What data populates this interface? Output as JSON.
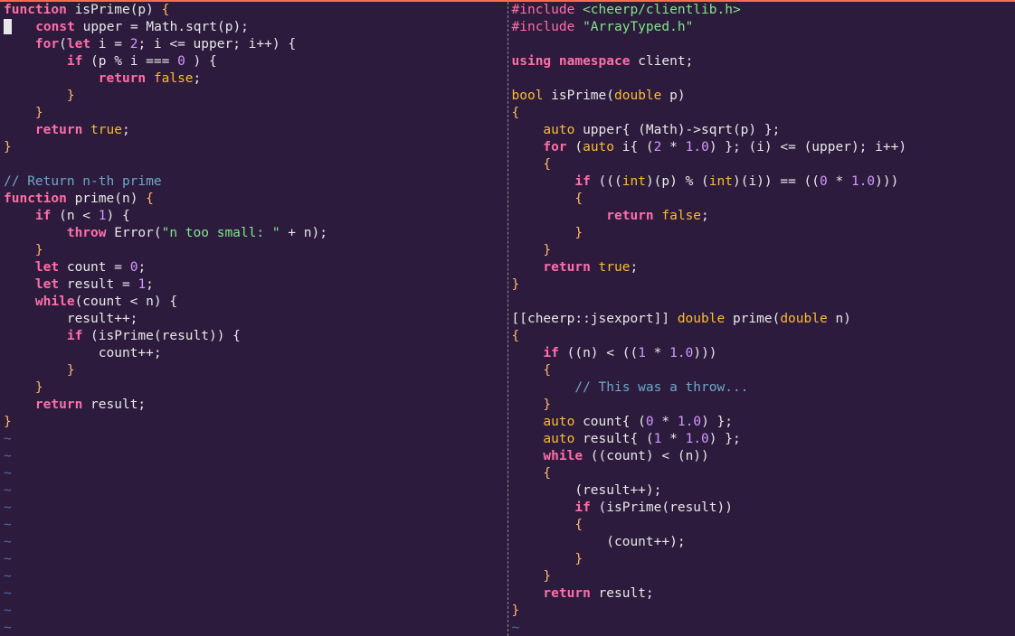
{
  "left": {
    "l1_fn": "function",
    "l1_name": "isPrime",
    "l1_p": "(p)",
    "l1_brace": " {",
    "l2_kw": "const",
    "l2_rest": " upper = Math.sqrt(p);",
    "l3_for": "for",
    "l3_open": "(",
    "l3_let": "let",
    "l3_rest1": " i = ",
    "l3_n2": "2",
    "l3_rest2": "; i <= upper; i++) {",
    "l4_if": "if",
    "l4_rest1": " (p % i === ",
    "l4_n0": "0",
    "l4_rest2": " ) {",
    "l5_ret": "return",
    "l5_sp": " ",
    "l5_false": "false",
    "l5_semi": ";",
    "l6": "        }",
    "l7": "    }",
    "l8_ret": "return",
    "l8_sp": " ",
    "l8_true": "true",
    "l8_semi": ";",
    "l9": "}",
    "blank": "",
    "c1": "// Return n-th prime",
    "p1_fn": "function",
    "p1_name": "prime",
    "p1_p": "(n)",
    "p1_brace": " {",
    "p2_if": "if",
    "p2_rest1": " (n < ",
    "p2_n1": "1",
    "p2_rest2": ") {",
    "p3_throw": "throw",
    "p3_err": " Error(",
    "p3_str": "\"n too small: \"",
    "p3_rest": " + n);",
    "p4": "    }",
    "p5_let": "let",
    "p5_rest": " count = ",
    "p5_n0": "0",
    "p5_semi": ";",
    "p6_let": "let",
    "p6_rest": " result = ",
    "p6_n1": "1",
    "p6_semi": ";",
    "p7_while": "while",
    "p7_rest": "(count < n) {",
    "p8": "        result++;",
    "p9_if": "if",
    "p9_rest": " (isPrime(result)) {",
    "p10": "            count++;",
    "p11": "        }",
    "p12": "    }",
    "p13_ret": "return",
    "p13_rest": " result;",
    "p14": "}",
    "tilde": "~"
  },
  "right": {
    "i1_inc": "#include ",
    "i1_val": "<cheerp/clientlib.h>",
    "i2_inc": "#include ",
    "i2_val": "\"ArrayTyped.h\"",
    "u1_using": "using",
    "u1_ns": " namespace ",
    "u1_client": "client",
    "u1_semi": ";",
    "f1_bool": "bool",
    "f1_name": " isPrime(",
    "f1_dbl": "double",
    "f1_rest": " p)",
    "f2": "{",
    "f3_auto": "auto",
    "f3_rest": " upper{ (Math)->sqrt(p) };",
    "f4_for": "for",
    "f4_open": " (",
    "f4_auto": "auto",
    "f4_rest1": " i{ (",
    "f4_n2": "2",
    "f4_rest2": " * ",
    "f4_n1": "1.0",
    "f4_rest3": ") }; (i) <= (upper); i++)",
    "f5": "    {",
    "f6_if": "if",
    "f6_rest1": " (((",
    "f6_int1": "int",
    "f6_rest2": ")(p) % (",
    "f6_int2": "int",
    "f6_rest3": ")(i)) == ((",
    "f6_n0": "0",
    "f6_rest4": " * ",
    "f6_n1": "1.0",
    "f6_rest5": ")))",
    "f7": "        {",
    "f8_ret": "return",
    "f8_sp": " ",
    "f8_false": "false",
    "f8_semi": ";",
    "f9": "        }",
    "f10": "    }",
    "f11_ret": "return",
    "f11_sp": " ",
    "f11_true": "true",
    "f11_semi": ";",
    "f12": "}",
    "g1_attr": "[[cheerp::jsexport]] ",
    "g1_dbl": "double",
    "g1_name": " prime(",
    "g1_dbl2": "double",
    "g1_rest": " n)",
    "g2": "{",
    "g3_if": "if",
    "g3_rest1": " ((n) < ((",
    "g3_n1": "1",
    "g3_rest2": " * ",
    "g3_n1b": "1.0",
    "g3_rest3": ")))",
    "g4": "    {",
    "g5_cmt": "// This was a throw...",
    "g6": "    }",
    "g7_auto": "auto",
    "g7_rest1": " count{ (",
    "g7_n0": "0",
    "g7_rest2": " * ",
    "g7_n1": "1.0",
    "g7_rest3": ") };",
    "g8_auto": "auto",
    "g8_rest1": " result{ (",
    "g8_n1": "1",
    "g8_rest2": " * ",
    "g8_n1b": "1.0",
    "g8_rest3": ") };",
    "g9_while": "while",
    "g9_rest": " ((count) < (n))",
    "g10": "    {",
    "g11": "        (result++);",
    "g12_if": "if",
    "g12_rest": " (isPrime(result))",
    "g13": "        {",
    "g14": "            (count++);",
    "g15": "        }",
    "g16": "    }",
    "g17_ret": "return",
    "g17_rest": " result;",
    "g18": "}",
    "tilde": "~"
  }
}
